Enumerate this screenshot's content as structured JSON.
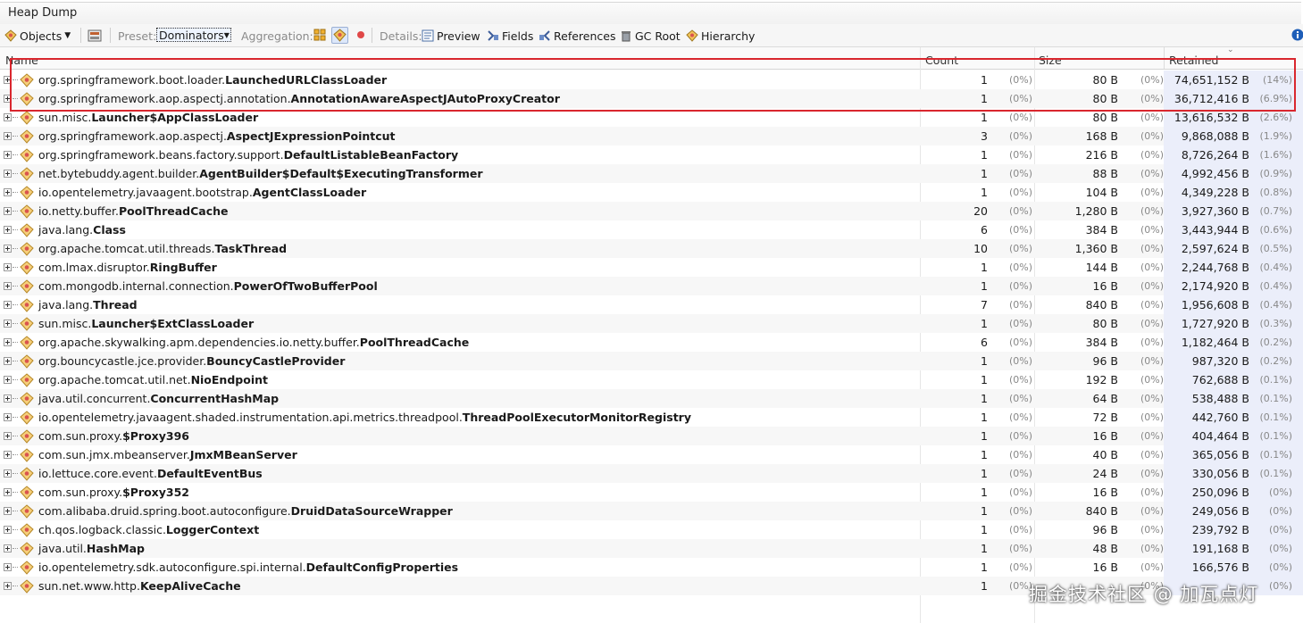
{
  "window": {
    "title": "Heap Dump"
  },
  "toolbar": {
    "objects_label": "Objects",
    "preset_label": "Preset:",
    "preset_value": "Dominators",
    "aggregation_label": "Aggregation:",
    "details_label": "Details:",
    "preview_label": "Preview",
    "fields_label": "Fields",
    "references_label": "References",
    "gcroot_label": "GC Root",
    "hierarchy_label": "Hierarchy"
  },
  "columns": {
    "name": "Name",
    "count": "Count",
    "size": "Size",
    "retained": "Retained"
  },
  "rows": [
    {
      "pkg": "org.springframework.boot.loader.",
      "cls": "LaunchedURLClassLoader",
      "count": "1",
      "count_pct": "(0%)",
      "size": "80 B",
      "size_pct": "(0%)",
      "retained": "74,651,152 B",
      "retained_pct": "(14%)"
    },
    {
      "pkg": "org.springframework.aop.aspectj.annotation.",
      "cls": "AnnotationAwareAspectJAutoProxyCreator",
      "count": "1",
      "count_pct": "(0%)",
      "size": "80 B",
      "size_pct": "(0%)",
      "retained": "36,712,416 B",
      "retained_pct": "(6.9%)"
    },
    {
      "pkg": "sun.misc.",
      "cls": "Launcher$AppClassLoader",
      "count": "1",
      "count_pct": "(0%)",
      "size": "80 B",
      "size_pct": "(0%)",
      "retained": "13,616,532 B",
      "retained_pct": "(2.6%)"
    },
    {
      "pkg": "org.springframework.aop.aspectj.",
      "cls": "AspectJExpressionPointcut",
      "count": "3",
      "count_pct": "(0%)",
      "size": "168 B",
      "size_pct": "(0%)",
      "retained": "9,868,088 B",
      "retained_pct": "(1.9%)"
    },
    {
      "pkg": "org.springframework.beans.factory.support.",
      "cls": "DefaultListableBeanFactory",
      "count": "1",
      "count_pct": "(0%)",
      "size": "216 B",
      "size_pct": "(0%)",
      "retained": "8,726,264 B",
      "retained_pct": "(1.6%)"
    },
    {
      "pkg": "net.bytebuddy.agent.builder.",
      "cls": "AgentBuilder$Default$ExecutingTransformer",
      "count": "1",
      "count_pct": "(0%)",
      "size": "88 B",
      "size_pct": "(0%)",
      "retained": "4,992,456 B",
      "retained_pct": "(0.9%)"
    },
    {
      "pkg": "io.opentelemetry.javaagent.bootstrap.",
      "cls": "AgentClassLoader",
      "count": "1",
      "count_pct": "(0%)",
      "size": "104 B",
      "size_pct": "(0%)",
      "retained": "4,349,228 B",
      "retained_pct": "(0.8%)"
    },
    {
      "pkg": "io.netty.buffer.",
      "cls": "PoolThreadCache",
      "count": "20",
      "count_pct": "(0%)",
      "size": "1,280 B",
      "size_pct": "(0%)",
      "retained": "3,927,360 B",
      "retained_pct": "(0.7%)"
    },
    {
      "pkg": "java.lang.",
      "cls": "Class",
      "count": "6",
      "count_pct": "(0%)",
      "size": "384 B",
      "size_pct": "(0%)",
      "retained": "3,443,944 B",
      "retained_pct": "(0.6%)"
    },
    {
      "pkg": "org.apache.tomcat.util.threads.",
      "cls": "TaskThread",
      "count": "10",
      "count_pct": "(0%)",
      "size": "1,360 B",
      "size_pct": "(0%)",
      "retained": "2,597,624 B",
      "retained_pct": "(0.5%)"
    },
    {
      "pkg": "com.lmax.disruptor.",
      "cls": "RingBuffer",
      "count": "1",
      "count_pct": "(0%)",
      "size": "144 B",
      "size_pct": "(0%)",
      "retained": "2,244,768 B",
      "retained_pct": "(0.4%)"
    },
    {
      "pkg": "com.mongodb.internal.connection.",
      "cls": "PowerOfTwoBufferPool",
      "count": "1",
      "count_pct": "(0%)",
      "size": "16 B",
      "size_pct": "(0%)",
      "retained": "2,174,920 B",
      "retained_pct": "(0.4%)"
    },
    {
      "pkg": "java.lang.",
      "cls": "Thread",
      "count": "7",
      "count_pct": "(0%)",
      "size": "840 B",
      "size_pct": "(0%)",
      "retained": "1,956,608 B",
      "retained_pct": "(0.4%)"
    },
    {
      "pkg": "sun.misc.",
      "cls": "Launcher$ExtClassLoader",
      "count": "1",
      "count_pct": "(0%)",
      "size": "80 B",
      "size_pct": "(0%)",
      "retained": "1,727,920 B",
      "retained_pct": "(0.3%)"
    },
    {
      "pkg": "org.apache.skywalking.apm.dependencies.io.netty.buffer.",
      "cls": "PoolThreadCache",
      "count": "6",
      "count_pct": "(0%)",
      "size": "384 B",
      "size_pct": "(0%)",
      "retained": "1,182,464 B",
      "retained_pct": "(0.2%)"
    },
    {
      "pkg": "org.bouncycastle.jce.provider.",
      "cls": "BouncyCastleProvider",
      "count": "1",
      "count_pct": "(0%)",
      "size": "96 B",
      "size_pct": "(0%)",
      "retained": "987,320 B",
      "retained_pct": "(0.2%)"
    },
    {
      "pkg": "org.apache.tomcat.util.net.",
      "cls": "NioEndpoint",
      "count": "1",
      "count_pct": "(0%)",
      "size": "192 B",
      "size_pct": "(0%)",
      "retained": "762,688 B",
      "retained_pct": "(0.1%)"
    },
    {
      "pkg": "java.util.concurrent.",
      "cls": "ConcurrentHashMap",
      "count": "1",
      "count_pct": "(0%)",
      "size": "64 B",
      "size_pct": "(0%)",
      "retained": "538,488 B",
      "retained_pct": "(0.1%)"
    },
    {
      "pkg": "io.opentelemetry.javaagent.shaded.instrumentation.api.metrics.threadpool.",
      "cls": "ThreadPoolExecutorMonitorRegistry",
      "count": "1",
      "count_pct": "(0%)",
      "size": "72 B",
      "size_pct": "(0%)",
      "retained": "442,760 B",
      "retained_pct": "(0.1%)"
    },
    {
      "pkg": "com.sun.proxy.",
      "cls": "$Proxy396",
      "count": "1",
      "count_pct": "(0%)",
      "size": "16 B",
      "size_pct": "(0%)",
      "retained": "404,464 B",
      "retained_pct": "(0.1%)"
    },
    {
      "pkg": "com.sun.jmx.mbeanserver.",
      "cls": "JmxMBeanServer",
      "count": "1",
      "count_pct": "(0%)",
      "size": "40 B",
      "size_pct": "(0%)",
      "retained": "365,056 B",
      "retained_pct": "(0.1%)"
    },
    {
      "pkg": "io.lettuce.core.event.",
      "cls": "DefaultEventBus",
      "count": "1",
      "count_pct": "(0%)",
      "size": "24 B",
      "size_pct": "(0%)",
      "retained": "330,056 B",
      "retained_pct": "(0.1%)"
    },
    {
      "pkg": "com.sun.proxy.",
      "cls": "$Proxy352",
      "count": "1",
      "count_pct": "(0%)",
      "size": "16 B",
      "size_pct": "(0%)",
      "retained": "250,096 B",
      "retained_pct": "(0%)"
    },
    {
      "pkg": "com.alibaba.druid.spring.boot.autoconfigure.",
      "cls": "DruidDataSourceWrapper",
      "count": "1",
      "count_pct": "(0%)",
      "size": "840 B",
      "size_pct": "(0%)",
      "retained": "249,056 B",
      "retained_pct": "(0%)"
    },
    {
      "pkg": "ch.qos.logback.classic.",
      "cls": "LoggerContext",
      "count": "1",
      "count_pct": "(0%)",
      "size": "96 B",
      "size_pct": "(0%)",
      "retained": "239,792 B",
      "retained_pct": "(0%)"
    },
    {
      "pkg": "java.util.",
      "cls": "HashMap",
      "count": "1",
      "count_pct": "(0%)",
      "size": "48 B",
      "size_pct": "(0%)",
      "retained": "191,168 B",
      "retained_pct": "(0%)"
    },
    {
      "pkg": "io.opentelemetry.sdk.autoconfigure.spi.internal.",
      "cls": "DefaultConfigProperties",
      "count": "1",
      "count_pct": "(0%)",
      "size": "16 B",
      "size_pct": "(0%)",
      "retained": "166,576 B",
      "retained_pct": "(0%)"
    },
    {
      "pkg": "sun.net.www.http.",
      "cls": "KeepAliveCache",
      "count": "1",
      "count_pct": "(0%)",
      "size": "",
      "size_pct": "(0%)",
      "retained": "",
      "retained_pct": "(0%)"
    }
  ],
  "watermark": "掘金技术社区 @ 加瓦点灯",
  "colors": {
    "highlight": "#d9272e",
    "retained_bg": "#ebeefa",
    "accent": "#1e5eb8"
  }
}
